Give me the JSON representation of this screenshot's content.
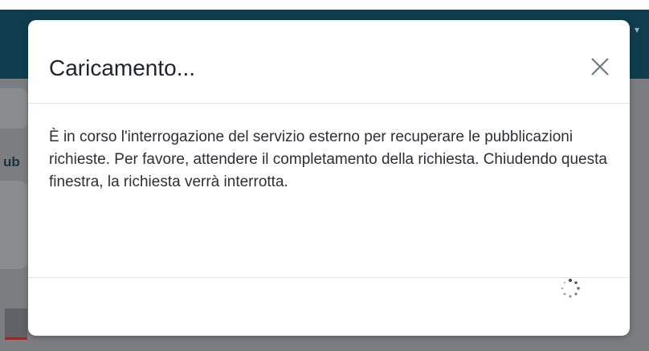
{
  "modal": {
    "title": "Caricamento...",
    "body": "È in corso l'interrogazione del servizio esterno per recuperare le pubblicazioni richieste. Per favore, attendere il completamento della richiesta. Chiudendo questa finestra, la richiesta verrà interrotta.",
    "close_icon": "close-icon",
    "spinner_icon": "spinner-icon"
  },
  "background": {
    "side_text": "ub",
    "navbar_color": "#0f3d4e"
  }
}
